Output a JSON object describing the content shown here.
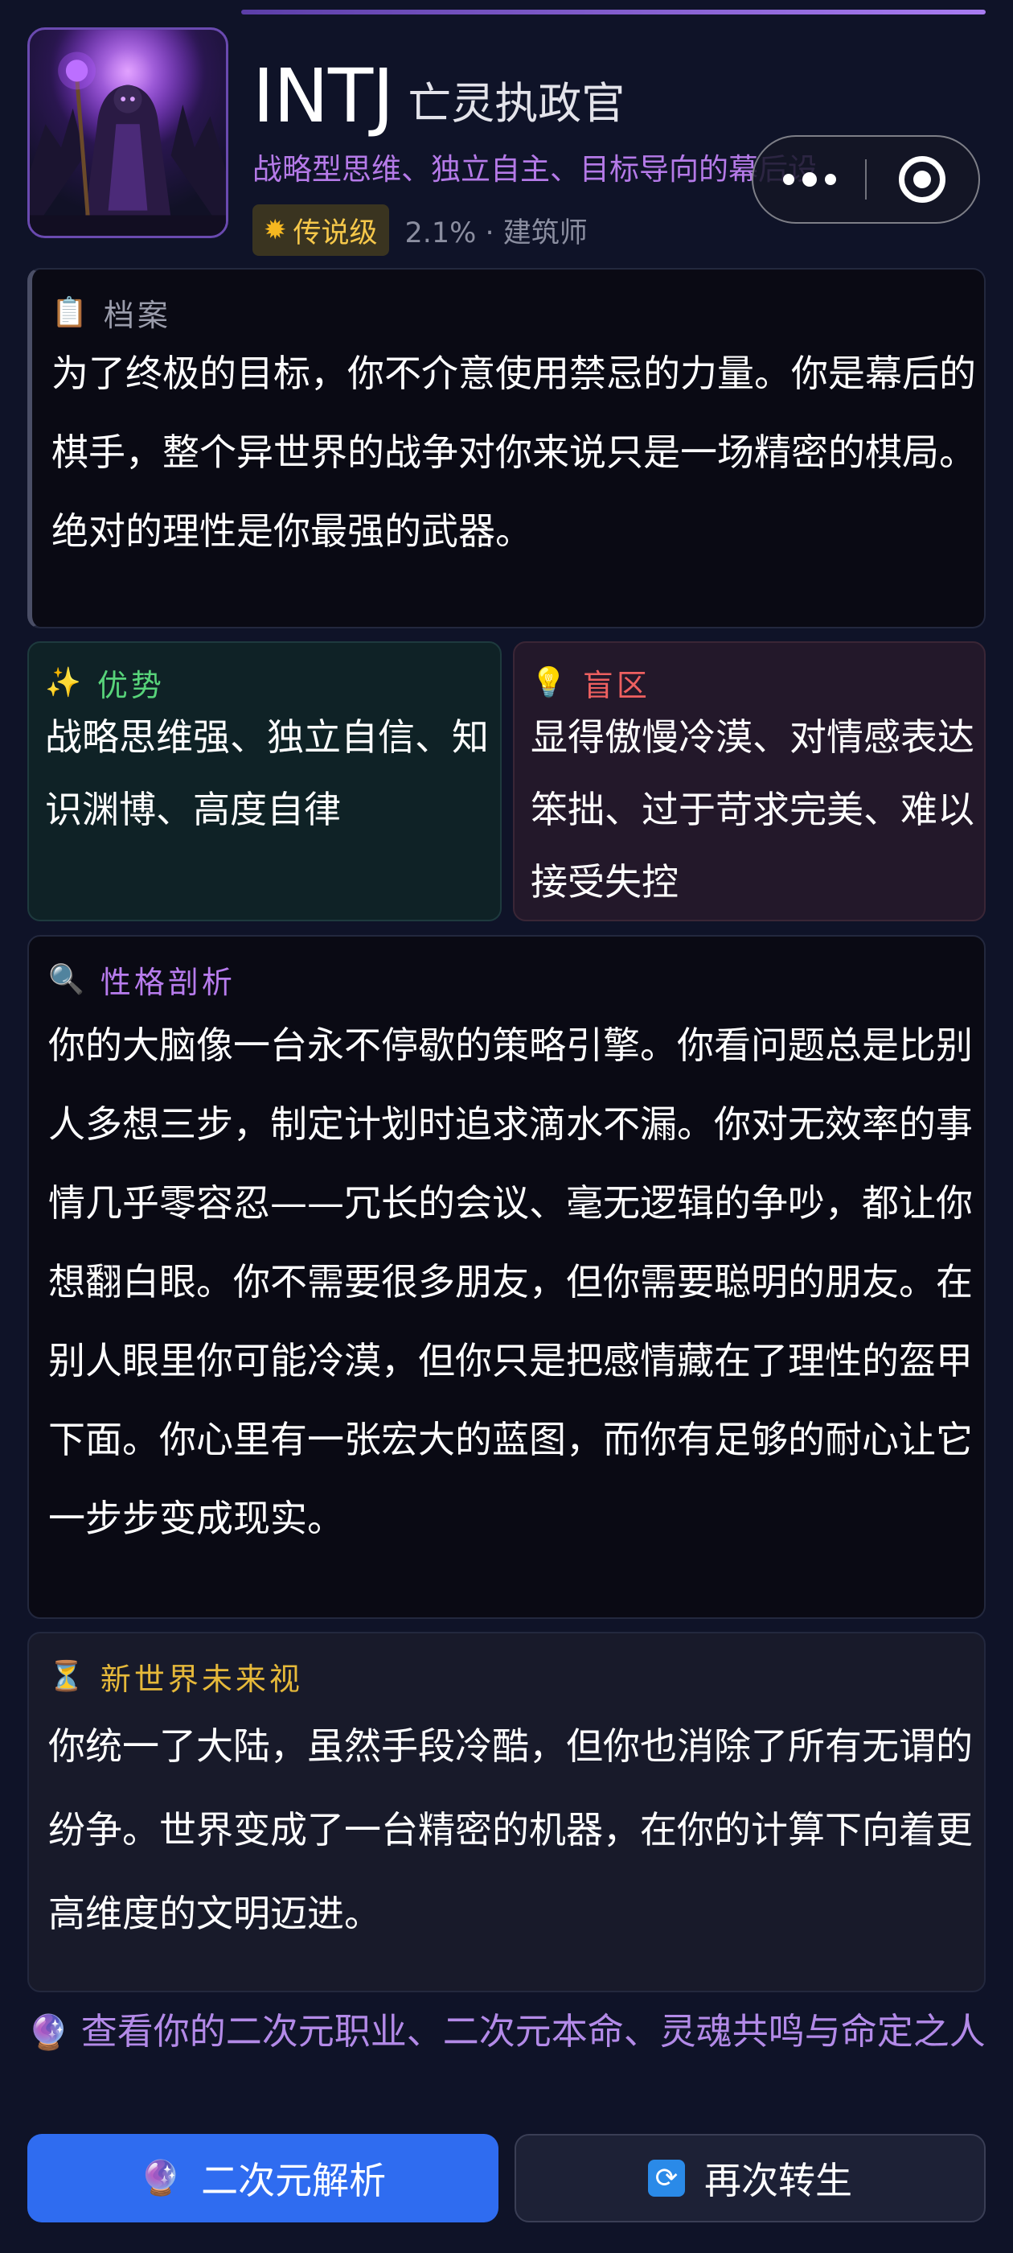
{
  "header": {
    "mbti": "INTJ",
    "role": "亡灵执政官",
    "tagline": "战略型思维、独立自主、目标导向的幕后设计师",
    "rarity": "传说级",
    "rarity_icon": "sun-icon",
    "stats": "2.1% · 建筑师"
  },
  "archive": {
    "icon": "📋",
    "label": "档案",
    "text": "为了终极的目标，你不介意使用禁忌的力量。你是幕后的棋手，整个异世界的战争对你来说只是一场精密的棋局。绝对的理性是你最强的武器。"
  },
  "strengths": {
    "icon": "✨",
    "label": "优势",
    "text": "战略思维强、独立自信、知识渊博、高度自律"
  },
  "blindspots": {
    "icon": "💡",
    "label": "盲区",
    "text": "显得傲慢冷漠、对情感表达笨拙、过于苛求完美、难以接受失控"
  },
  "analysis": {
    "icon": "🔍",
    "label": "性格剖析",
    "text": "你的大脑像一台永不停歇的策略引擎。你看问题总是比别人多想三步，制定计划时追求滴水不漏。你对无效率的事情几乎零容忍——冗长的会议、毫无逻辑的争吵，都让你想翻白眼。你不需要很多朋友，但你需要聪明的朋友。在别人眼里你可能冷漠，但你只是把感情藏在了理性的盔甲下面。你心里有一张宏大的蓝图，而你有足够的耐心让它一步步变成现实。"
  },
  "future": {
    "icon": "⏳",
    "label": "新世界未来视",
    "text": "你统一了大陆，虽然手段冷酷，但你也消除了所有无谓的纷争。世界变成了一台精密的机器，在你的计算下向着更高维度的文明迈进。"
  },
  "cta": {
    "icon": "🔮",
    "text": "查看你的二次元职业、二次元本命、灵魂共鸣与命定之人"
  },
  "buttons": {
    "analyze_icon": "🔮",
    "analyze": "二次元解析",
    "reroll_icon": "🔄",
    "reroll": "再次转生"
  },
  "colors": {
    "background": "#0f1328",
    "accent_purple": "#b57ae8",
    "legendary_gold": "#f6c84a",
    "strength_green": "#58d47a",
    "blind_red": "#ee6060",
    "future_gold": "#e6b93a",
    "primary_blue": "#2f6cf0"
  }
}
